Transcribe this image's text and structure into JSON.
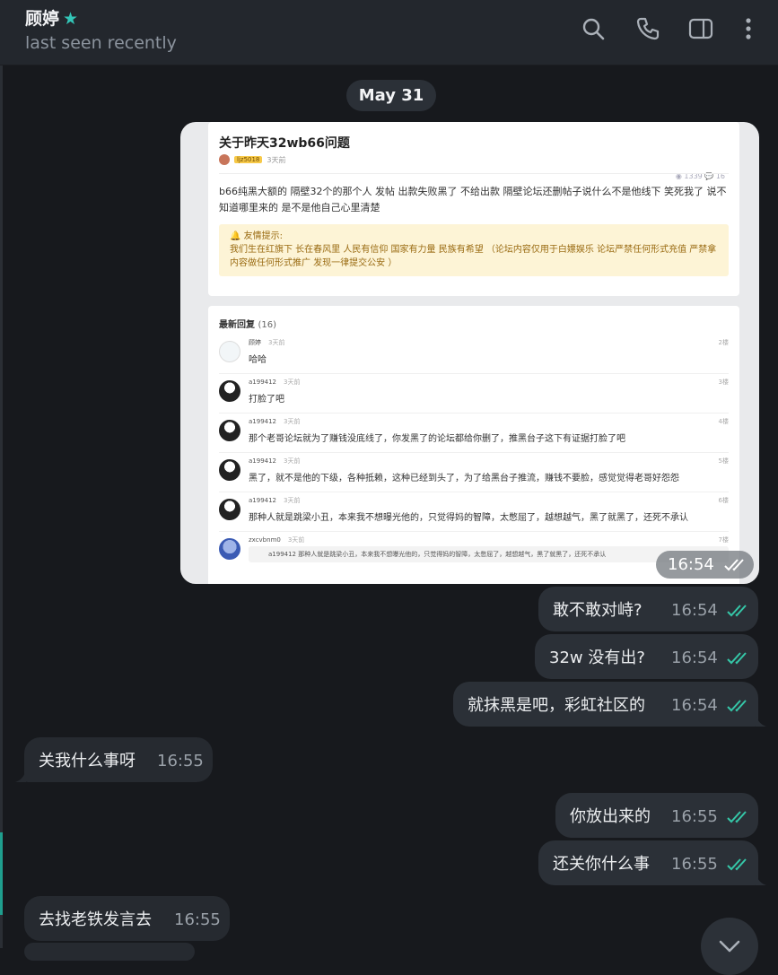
{
  "header": {
    "contact_name": "顾婷",
    "star": "★",
    "status": "last seen recently",
    "icons": [
      "search-icon",
      "phone-icon",
      "sidebar-toggle-icon",
      "more-icon"
    ]
  },
  "date_separator": "May 31",
  "photo": {
    "time": "16:54",
    "post": {
      "title": "关于昨天32wb66问题",
      "badge": "ljz5018",
      "time": "3天前",
      "stats": "◉ 1339   💬 16",
      "body": "b66纯黑大额的 隔壁32个的那个人 发帖 出款失败黑了 不给出款 隔壁论坛还删帖子说什么不是他线下 笑死我了 说不知道哪里来的 是不是他自己心里清楚",
      "tip_title": "🔔 友情提示:",
      "tip_body": "我们生在红旗下 长在春风里 人民有信仰 国家有力量 民族有希望 （论坛内容仅用于白嫖娱乐 论坛严禁任何形式充值 严禁拿内容做任何形式推广 发现一律提交公安 ）"
    },
    "replies_header": "最新回复",
    "replies_count": "(16)",
    "replies": [
      {
        "user": "顾婷",
        "time": "3天前",
        "floor": "2楼",
        "text": "哈哈"
      },
      {
        "user": "a199412",
        "time": "3天前",
        "floor": "3楼",
        "text": "打脸了吧"
      },
      {
        "user": "a199412",
        "time": "3天前",
        "floor": "4楼",
        "text": "那个老哥论坛就为了赚钱没底线了，你发黑了的论坛都给你删了，推黑台子这下有证据打脸了吧"
      },
      {
        "user": "a199412",
        "time": "3天前",
        "floor": "5楼",
        "text": "黑了，就不是他的下级，各种抵赖，这种已经到头了，为了给黑台子推流，赚钱不要脸，感觉觉得老哥好怨怨"
      },
      {
        "user": "a199412",
        "time": "3天前",
        "floor": "6楼",
        "text": "那种人就是跳梁小丑，本来我不想曝光他的，只觉得妈的智障，太憋屈了，越想越气，黑了就黑了，还死不承认"
      },
      {
        "user": "zxcvbnm0",
        "time": "3天前",
        "floor": "7楼",
        "text": "a199412   那种人就是跳梁小丑，本来我不想曝光他的，只觉得妈的智障，太憋屈了，越想越气，黑了就黑了，还死不承认"
      }
    ]
  },
  "messages": [
    {
      "text": "敢不敢对峙?",
      "time": "16:54",
      "dir": "out"
    },
    {
      "text": "32w 没有出?",
      "time": "16:54",
      "dir": "out"
    },
    {
      "text": "就抹黑是吧，彩虹社区的",
      "time": "16:54",
      "dir": "out"
    },
    {
      "text": "关我什么事呀",
      "time": "16:55",
      "dir": "in"
    },
    {
      "text": "你放出来的",
      "time": "16:55",
      "dir": "out"
    },
    {
      "text": "还关你什么事",
      "time": "16:55",
      "dir": "out"
    },
    {
      "text": "去找老铁发言去",
      "time": "16:55",
      "dir": "in"
    }
  ],
  "colors": {
    "accent": "#33c6b8",
    "check": "#35c7a8",
    "bubble_out": "#2b3037",
    "bubble_in": "#262a30",
    "background": "#17191d"
  }
}
